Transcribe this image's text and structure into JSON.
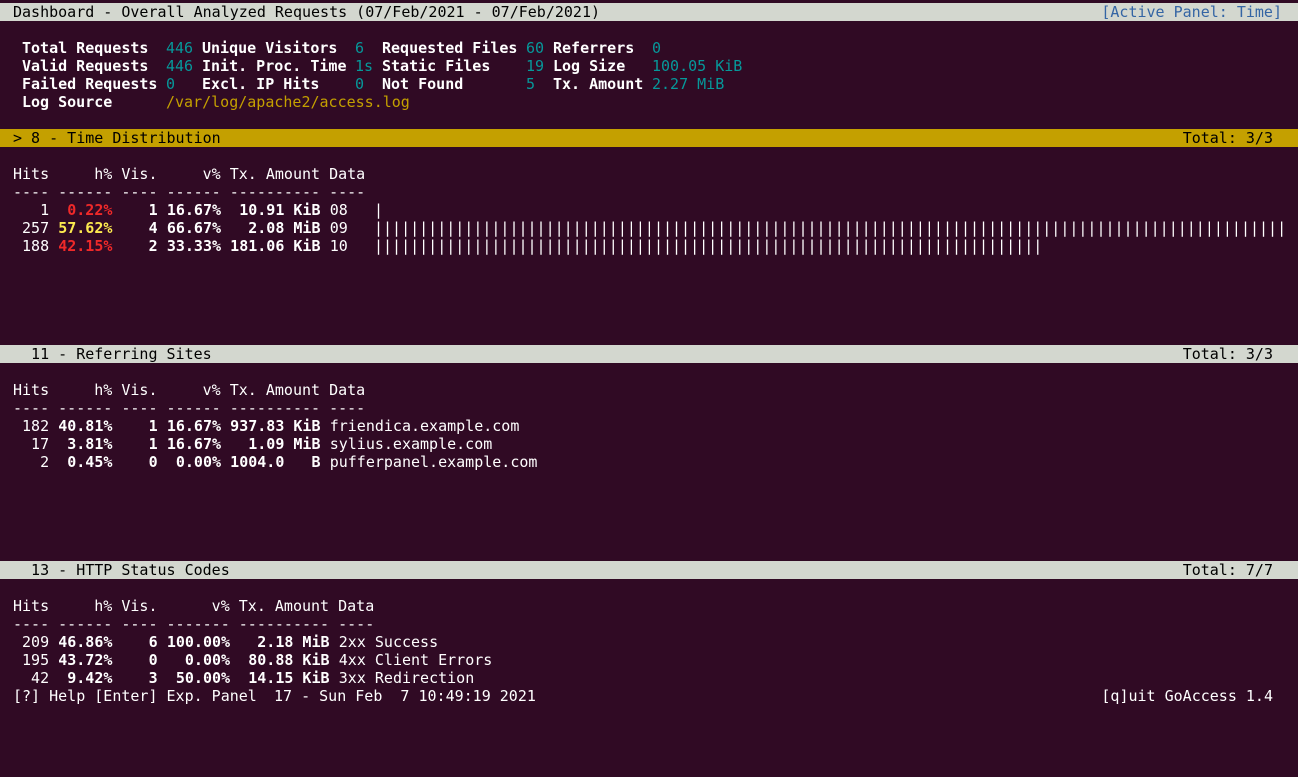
{
  "title_bar": {
    "title": "Dashboard - Overall Analyzed Requests (07/Feb/2021 - 07/Feb/2021)",
    "active_panel": "[Active Panel: Time]"
  },
  "overview": {
    "total_requests_label": "Total Requests",
    "total_requests": "446",
    "unique_visitors_label": "Unique Visitors",
    "unique_visitors": "6",
    "requested_files_label": "Requested Files",
    "requested_files": "60",
    "referrers_label": "Referrers",
    "referrers": "0",
    "valid_requests_label": "Valid Requests",
    "valid_requests": "446",
    "init_proc_time_label": "Init. Proc. Time",
    "init_proc_time": "1s",
    "static_files_label": "Static Files",
    "static_files": "19",
    "log_size_label": "Log Size",
    "log_size": "100.05 KiB",
    "failed_requests_label": "Failed Requests",
    "failed_requests": "0",
    "excl_ip_hits_label": "Excl. IP Hits",
    "excl_ip_hits": "0",
    "not_found_label": "Not Found",
    "not_found": "5",
    "tx_amount_label": "Tx. Amount",
    "tx_amount": "2.27 MiB",
    "log_source_label": "Log Source",
    "log_source": "/var/log/apache2/access.log"
  },
  "panels": {
    "time": {
      "header": "> 8 - Time Distribution",
      "total": "Total: 3/3",
      "columns": "Hits     h% Vis.     v% Tx. Amount Data",
      "separator": "---- ------ ---- ------ ---------- ----",
      "rows": [
        {
          "hits": "   1",
          "hpct": " 0.22%",
          "vis": "   1",
          "vpct": "16.67%",
          "tx": " 10.91 KiB",
          "data": "08",
          "bar_fraction": 0.0039
        },
        {
          "hits": " 257",
          "hpct": "57.62%",
          "vis": "   4",
          "vpct": "66.67%",
          "tx": "  2.08 MiB",
          "data": "09",
          "bar_fraction": 1.0
        },
        {
          "hits": " 188",
          "hpct": "42.15%",
          "vis": "   2",
          "vpct": "33.33%",
          "tx": "181.06 KiB",
          "data": "10",
          "bar_fraction": 0.7315
        }
      ]
    },
    "referring": {
      "header": "  11 - Referring Sites",
      "total": "Total: 3/3",
      "columns": "Hits     h% Vis.     v% Tx. Amount Data",
      "separator": "---- ------ ---- ------ ---------- ----",
      "rows": [
        {
          "hits": " 182",
          "hpct": "40.81%",
          "vis": "   1",
          "vpct": "16.67%",
          "tx": "937.83 KiB",
          "data": "friendica.example.com"
        },
        {
          "hits": "  17",
          "hpct": " 3.81%",
          "vis": "   1",
          "vpct": "16.67%",
          "tx": "  1.09 MiB",
          "data": "sylius.example.com"
        },
        {
          "hits": "   2",
          "hpct": " 0.45%",
          "vis": "   0",
          "vpct": " 0.00%",
          "tx": "1004.0   B",
          "data": "pufferpanel.example.com"
        }
      ]
    },
    "status": {
      "header": "  13 - HTTP Status Codes",
      "total": "Total: 7/7",
      "columns": "Hits     h% Vis.      v% Tx. Amount Data",
      "separator": "---- ------ ---- ------- ---------- ----",
      "rows": [
        {
          "hits": " 209",
          "hpct": "46.86%",
          "vis": "   6",
          "vpct": "100.00%",
          "tx": "  2.18 MiB",
          "data": "2xx Success"
        },
        {
          "hits": " 195",
          "hpct": "43.72%",
          "vis": "   0",
          "vpct": "  0.00%",
          "tx": " 80.88 KiB",
          "data": "4xx Client Errors"
        },
        {
          "hits": "  42",
          "hpct": " 9.42%",
          "vis": "   3",
          "vpct": " 50.00%",
          "tx": " 14.15 KiB",
          "data": "3xx Redirection"
        }
      ]
    }
  },
  "footer": {
    "help": "[?] Help [Enter] Exp. Panel",
    "timestamp": "17 - Sun Feb  7 10:49:19 2021",
    "quit": "[q]uit GoAccess 1.4"
  },
  "colors": {
    "background": "#300a24",
    "header_bar": "#d3d7cf",
    "active_header": "#c4a000",
    "teal_value": "#06989a",
    "log_source": "#c4a000",
    "low_pct": "#ef2929",
    "high_pct": "#fce94f"
  }
}
